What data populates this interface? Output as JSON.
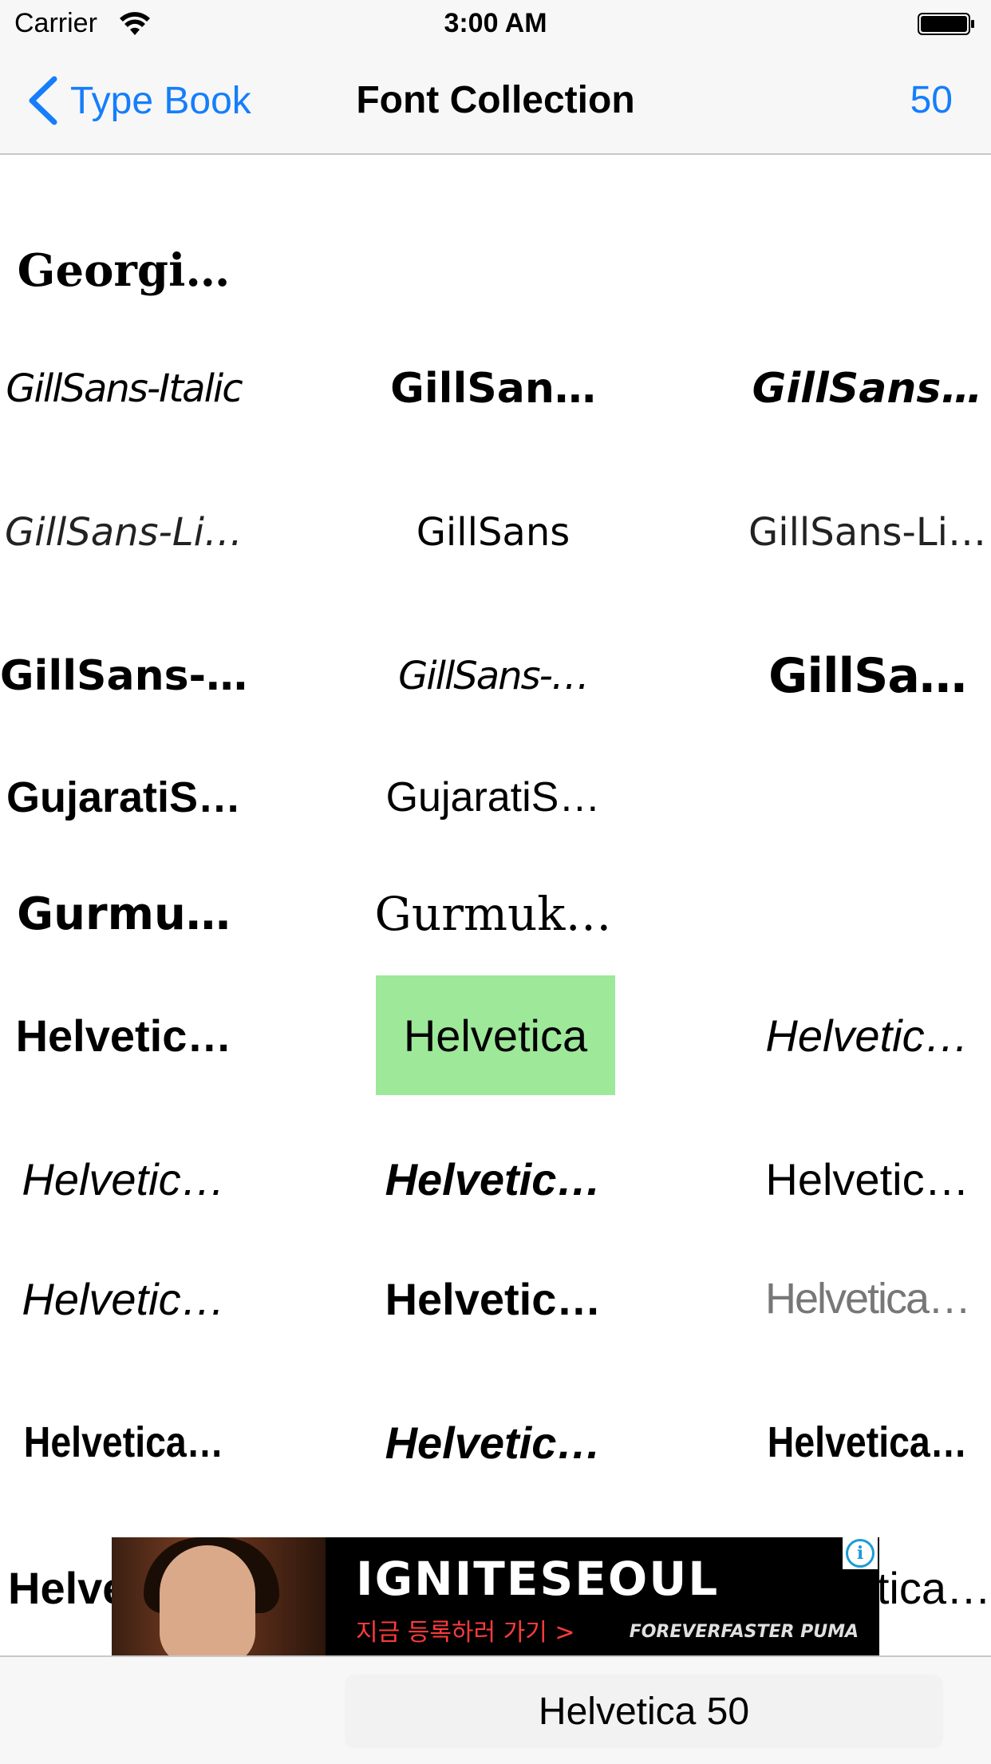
{
  "status_bar": {
    "carrier": "Carrier",
    "time": "3:00 AM"
  },
  "nav": {
    "back_label": "Type Book",
    "title": "Font Collection",
    "count": "50"
  },
  "grid": {
    "rows": [
      [
        "Georgi…",
        "",
        ""
      ],
      [
        "GillSans-Italic",
        "GillSan…",
        "GillSans…"
      ],
      [
        "GillSans-Li…",
        "GillSans",
        "GillSans-Li…"
      ],
      [
        "GillSans-…",
        "GillSans-…",
        "GillSa…"
      ],
      [
        "GujaratiS…",
        "GujaratiS…",
        ""
      ],
      [
        "Gurmu…",
        "Gurmuk…",
        ""
      ],
      [
        "Helvetic…",
        "Helvetica",
        "Helvetic…"
      ],
      [
        "Helvetic…",
        "Helvetic…",
        "Helvetic…"
      ],
      [
        "Helvetic…",
        "Helvetic…",
        "Helvetica…"
      ],
      [
        "Helvetica…",
        "Helvetic…",
        "Helvetica…"
      ],
      [
        "Helve",
        "",
        "tica…"
      ]
    ],
    "selected_font": "Helvetica"
  },
  "ad": {
    "title": "IGNITESEOUL",
    "subtitle": "지금 등록하러 가기 >",
    "brand": "FOREVERFASTER PUMA",
    "info_icon": "info-icon"
  },
  "toolbar": {
    "selected_label": "Helvetica 50"
  },
  "colors": {
    "accent": "#157efb",
    "selected_bg": "#9ee89a",
    "bar_bg": "#f7f7f7"
  }
}
